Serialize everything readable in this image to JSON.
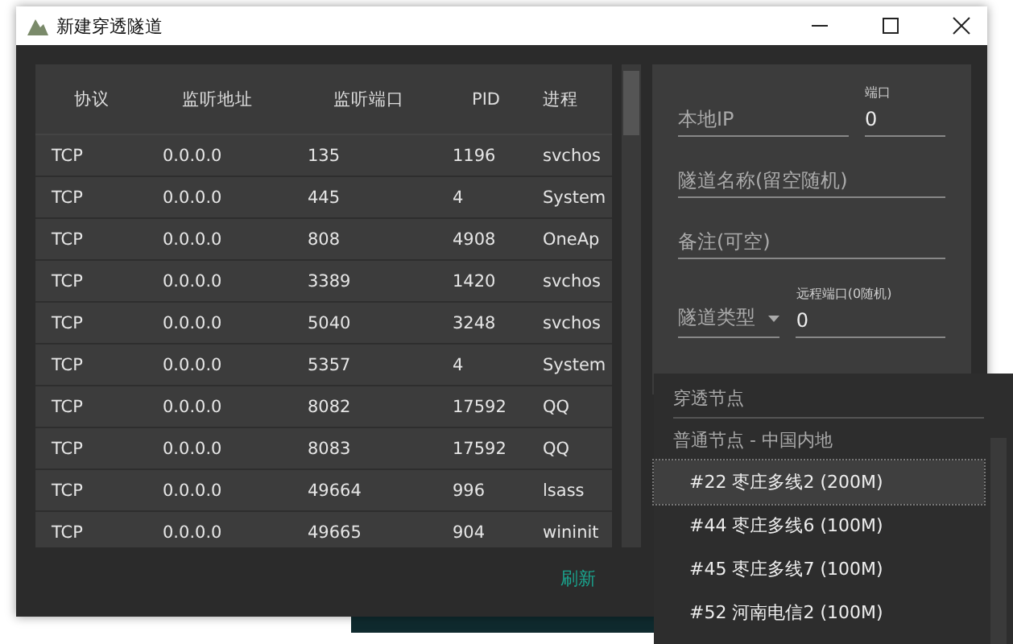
{
  "window": {
    "title": "新建穿透隧道"
  },
  "table": {
    "columns": [
      "协议",
      "监听地址",
      "监听端口",
      "PID",
      "进程"
    ],
    "rows": [
      [
        "TCP",
        "0.0.0.0",
        "135",
        "1196",
        "svchos"
      ],
      [
        "TCP",
        "0.0.0.0",
        "445",
        "4",
        "System"
      ],
      [
        "TCP",
        "0.0.0.0",
        "808",
        "4908",
        "OneAp"
      ],
      [
        "TCP",
        "0.0.0.0",
        "3389",
        "1420",
        "svchos"
      ],
      [
        "TCP",
        "0.0.0.0",
        "5040",
        "3248",
        "svchos"
      ],
      [
        "TCP",
        "0.0.0.0",
        "5357",
        "4",
        "System"
      ],
      [
        "TCP",
        "0.0.0.0",
        "8082",
        "17592",
        "QQ"
      ],
      [
        "TCP",
        "0.0.0.0",
        "8083",
        "17592",
        "QQ"
      ],
      [
        "TCP",
        "0.0.0.0",
        "49664",
        "996",
        "lsass"
      ],
      [
        "TCP",
        "0.0.0.0",
        "49665",
        "904",
        "wininit"
      ]
    ]
  },
  "form": {
    "local_ip": {
      "placeholder": "本地IP"
    },
    "port": {
      "label": "端口",
      "value": "0"
    },
    "tunnel_name": {
      "placeholder": "隧道名称(留空随机)"
    },
    "remark": {
      "placeholder": "备注(可空)"
    },
    "tunnel_type": {
      "placeholder": "隧道类型"
    },
    "remote_port": {
      "label": "远程端口(0随机)",
      "value": "0"
    }
  },
  "refresh_button": "刷新",
  "node_dropdown": {
    "label": "穿透节点",
    "group": "普通节点 - 中国内地",
    "options": [
      {
        "label": "#22 枣庄多线2 (200M)",
        "selected": true
      },
      {
        "label": "#44 枣庄多线6 (100M)",
        "selected": false
      },
      {
        "label": "#45 枣庄多线7 (100M)",
        "selected": false
      },
      {
        "label": "#52 河南电信2 (100M)",
        "selected": false
      }
    ]
  }
}
